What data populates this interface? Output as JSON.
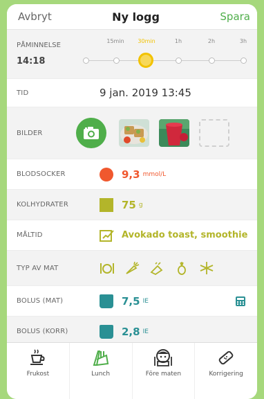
{
  "nav": {
    "cancel": "Avbryt",
    "title": "Ny logg",
    "save": "Spara"
  },
  "reminder": {
    "label": "PÅMINNELSE",
    "time": "14:18",
    "options": [
      "15min",
      "30min",
      "1h",
      "2h",
      "3h"
    ],
    "selected": "30min"
  },
  "tid": {
    "label": "TID",
    "value": "9 jan. 2019 13:45"
  },
  "bilder": {
    "label": "BILDER",
    "camera_icon": "camera-icon"
  },
  "blodsocker": {
    "label": "BLODSOCKER",
    "value": "9,3",
    "unit": "mmol/L"
  },
  "kolhydrater": {
    "label": "KOLHYDRATER",
    "value": "75",
    "unit": "g"
  },
  "maltid": {
    "label": "MÅLTID",
    "value": "Avokado toast, smoothie"
  },
  "typ_av_mat": {
    "label": "TYP AV MAT",
    "icons": [
      "plate-icon",
      "carrot-icon",
      "bread-icon",
      "pineapple-icon",
      "snowflake-icon"
    ]
  },
  "bolus_mat": {
    "label": "BOLUS (MAT)",
    "value": "7,5",
    "unit": "IE"
  },
  "bolus_korr": {
    "label": "BOLUS (KORR)",
    "value": "2,8",
    "unit": "IE"
  },
  "tiles": [
    {
      "label": "Frukost",
      "icon": "coffee-cup-icon"
    },
    {
      "label": "Lunch",
      "icon": "lunch-icon"
    },
    {
      "label": "Före maten",
      "icon": "person-eating-icon"
    },
    {
      "label": "Korrigering",
      "icon": "bandage-icon"
    }
  ],
  "colors": {
    "green": "#4fae4a",
    "red": "#f0582e",
    "olive": "#b3b52a",
    "teal": "#2a9094",
    "yellow": "#f2c200",
    "background": "#a6d87c"
  }
}
